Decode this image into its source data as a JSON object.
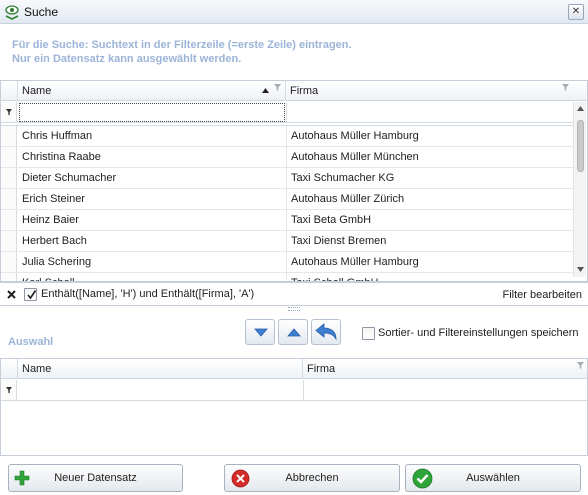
{
  "window": {
    "title": "Suche",
    "close_glyph": "✕"
  },
  "instructions": {
    "line1": "Für die Suche: Suchtext in der Filterzeile (=erste Zeile) eintragen.",
    "line2": "Nur ein Datensatz kann ausgewählt werden."
  },
  "search_grid": {
    "columns": [
      "Name",
      "Firma"
    ],
    "filter_values": [
      "",
      ""
    ],
    "rows": [
      {
        "name": "Chris Huffman",
        "firma": "Autohaus Müller Hamburg"
      },
      {
        "name": "Christina Raabe",
        "firma": "Autohaus Müller München"
      },
      {
        "name": "Dieter Schumacher",
        "firma": "Taxi Schumacher KG"
      },
      {
        "name": "Erich Steiner",
        "firma": "Autohaus Müller Zürich"
      },
      {
        "name": "Heinz Baier",
        "firma": "Taxi Beta GmbH"
      },
      {
        "name": "Herbert Bach",
        "firma": "Taxi Dienst Bremen"
      },
      {
        "name": "Julia Schering",
        "firma": "Autohaus Müller Hamburg"
      },
      {
        "name": "Karl Scholl",
        "firma": "Taxi Scholl GmbH"
      }
    ]
  },
  "filter_bar": {
    "expression": "Enthält([Name], 'H') und Enthält([Firma], 'A')",
    "enabled": true,
    "edit_label": "Filter bearbeiten"
  },
  "selection": {
    "title": "Auswahl",
    "save_settings_label": "Sortier- und Filtereinstellungen speichern",
    "save_settings_checked": false,
    "columns": [
      "Name",
      "Firma"
    ]
  },
  "buttons": {
    "new_record": "Neuer Datensatz",
    "cancel": "Abbrechen",
    "select": "Auswählen"
  },
  "colors": {
    "hint_text": "#9cb4d8",
    "section_title": "#9cb4d8",
    "accent_blue": "#3d7fd0",
    "green": "#2ea43a",
    "red": "#d42a2a"
  }
}
